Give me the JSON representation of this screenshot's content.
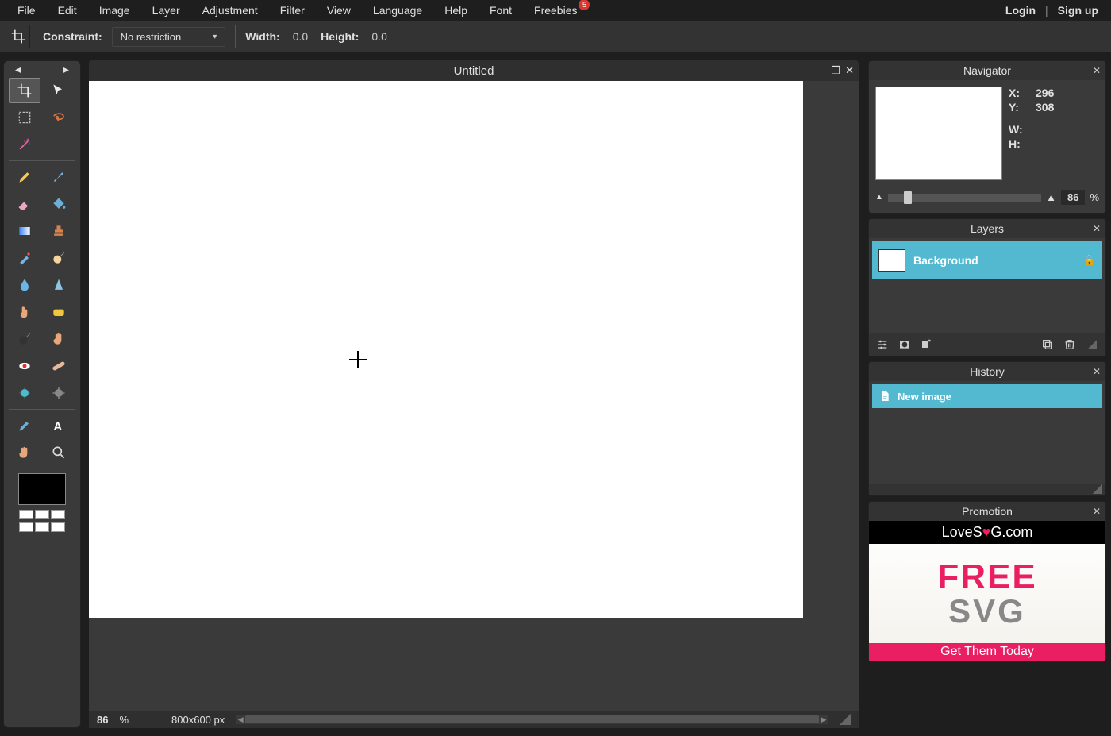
{
  "menu": {
    "items": [
      "File",
      "Edit",
      "Image",
      "Layer",
      "Adjustment",
      "Filter",
      "View",
      "Language",
      "Help",
      "Font",
      "Freebies"
    ],
    "freebies_badge": "5",
    "login": "Login",
    "signup": "Sign up"
  },
  "options": {
    "constraint_label": "Constraint:",
    "constraint_value": "No restriction",
    "width_label": "Width:",
    "width_value": "0.0",
    "height_label": "Height:",
    "height_value": "0.0"
  },
  "document": {
    "title": "Untitled",
    "zoom_footer": "86",
    "percent": "%",
    "dimensions": "800x600 px"
  },
  "navigator": {
    "title": "Navigator",
    "x_label": "X:",
    "x_value": "296",
    "y_label": "Y:",
    "y_value": "308",
    "w_label": "W:",
    "w_value": "",
    "h_label": "H:",
    "h_value": "",
    "zoom": "86",
    "percent": "%"
  },
  "layers": {
    "title": "Layers",
    "items": [
      {
        "name": "Background",
        "locked": true
      }
    ]
  },
  "history": {
    "title": "History",
    "items": [
      {
        "label": "New image"
      }
    ]
  },
  "promotion": {
    "title": "Promotion",
    "brand_prefix": "LoveS",
    "brand_suffix": "G.com",
    "line1": "FREE",
    "line2": "SVG",
    "cta": "Get Them Today"
  },
  "tools": [
    "crop-tool",
    "move-tool",
    "marquee-tool",
    "lasso-tool",
    "wand-tool",
    "",
    "pencil-tool",
    "brush-tool",
    "eraser-tool",
    "bucket-tool",
    "gradient-tool",
    "stamp-tool",
    "colorreplace-tool",
    "dodge-tool",
    "blur-tool",
    "sharpen-tool",
    "smudge-tool",
    "sponge-tool",
    "zoomblur-tool",
    "pinch-tool",
    "redeye-tool",
    "heal-tool",
    "bloat-tool",
    "liquify-tool",
    "eyedropper-tool",
    "type-tool",
    "hand-tool",
    "zoom-tool"
  ]
}
